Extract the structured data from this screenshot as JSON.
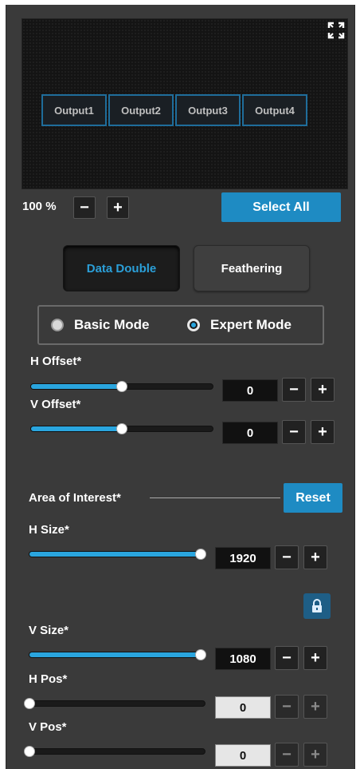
{
  "preview": {
    "outputs": [
      "Output1",
      "Output2",
      "Output3",
      "Output4"
    ],
    "fullscreen_icon": "fullscreen-icon"
  },
  "zoom": {
    "value": "100 %",
    "minus": "−",
    "plus": "+"
  },
  "select_all_label": "Select All",
  "tabs": [
    {
      "label": "Data Double",
      "active": true
    },
    {
      "label": "Feathering",
      "active": false
    }
  ],
  "mode": {
    "options": [
      {
        "label": "Basic Mode",
        "selected": false
      },
      {
        "label": "Expert Mode",
        "selected": true
      }
    ]
  },
  "h_offset": {
    "label": "H Offset*",
    "value": "0",
    "level": 0.5
  },
  "v_offset": {
    "label": "V Offset*",
    "value": "0",
    "level": 0.5
  },
  "aoi": {
    "label": "Area of Interest*",
    "reset_label": "Reset",
    "lock_icon": "lock-icon"
  },
  "h_size": {
    "label": "H Size*",
    "value": "1920",
    "level": 1.0
  },
  "v_size": {
    "label": "V Size*",
    "value": "1080",
    "level": 1.0
  },
  "h_pos": {
    "label": "H Pos*",
    "value": "0",
    "level": 0.0
  },
  "v_pos": {
    "label": "V Pos*",
    "value": "0",
    "level": 0.0
  },
  "colors": {
    "accent": "#1e8bc3",
    "fill": "#2aa5de",
    "panel": "#3a3a3a",
    "output_border": "#1f6d9b"
  }
}
